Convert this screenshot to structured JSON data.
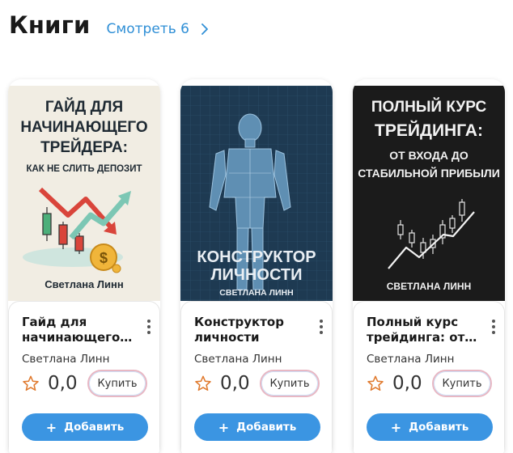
{
  "section": {
    "title": "Книги",
    "see_all": "Смотреть 6"
  },
  "books": [
    {
      "cover_lines": [
        "ГАЙД ДЛЯ",
        "НАЧИНАЮЩЕГО",
        "ТРЕЙДЕРА:"
      ],
      "cover_subtitle": "КАК НЕ СЛИТЬ ДЕПОЗИТ",
      "cover_author": "Светлана Линн",
      "title": "Гайд для начинающего…",
      "author": "Светлана Линн",
      "rating": "0,0",
      "buy_label": "Купить",
      "add_label": "Добавить"
    },
    {
      "cover_lines": [
        "КОНСТРУКТОР",
        "ЛИЧНОСТИ"
      ],
      "cover_author": "СВЕТЛАНА ЛИНН",
      "title": "Конструктор личности",
      "author": "Светлана Линн",
      "rating": "0,0",
      "buy_label": "Купить",
      "add_label": "Добавить"
    },
    {
      "cover_lines": [
        "ПОЛНЫЙ КУРС",
        "ТРЕЙДИНГА:"
      ],
      "cover_subtitle_lines": [
        "ОТ ВХОДА ДО",
        "СТАБИЛЬНОЙ ПРИБЫЛИ"
      ],
      "cover_author": "СВЕТЛАНА ЛИНН",
      "title": "Полный курс трейдинга: от…",
      "author": "Светлана Линн",
      "rating": "0,0",
      "buy_label": "Купить",
      "add_label": "Добавить"
    }
  ],
  "colors": {
    "accent_blue": "#3b95e2",
    "link_blue": "#2f8fd6",
    "cover1_bg": "#f1ede3",
    "cover2_bg": "#1e3a52",
    "cover3_bg": "#1b1b1b"
  },
  "icons": {
    "see_all": "chevron-right-icon",
    "rating": "star-outline-icon",
    "menu": "more-vertical-icon",
    "add": "plus-icon"
  }
}
